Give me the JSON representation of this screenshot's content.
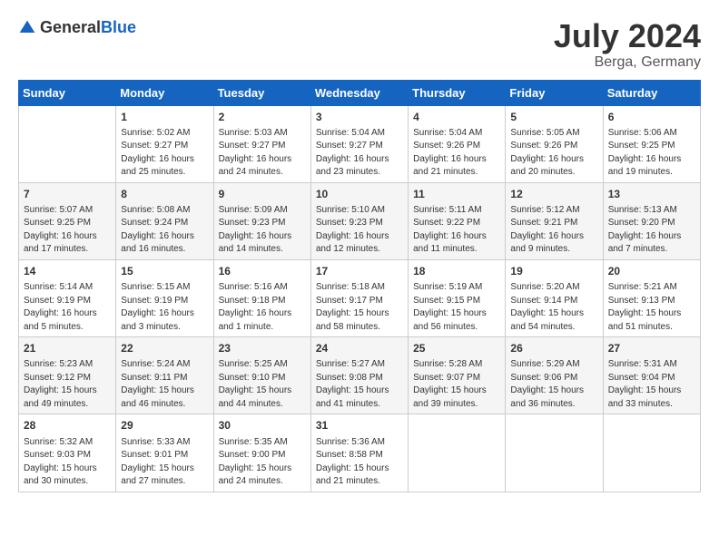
{
  "header": {
    "logo_general": "General",
    "logo_blue": "Blue",
    "month_year": "July 2024",
    "location": "Berga, Germany"
  },
  "calendar": {
    "days_of_week": [
      "Sunday",
      "Monday",
      "Tuesday",
      "Wednesday",
      "Thursday",
      "Friday",
      "Saturday"
    ],
    "weeks": [
      [
        {
          "day": "",
          "info": ""
        },
        {
          "day": "1",
          "info": "Sunrise: 5:02 AM\nSunset: 9:27 PM\nDaylight: 16 hours\nand 25 minutes."
        },
        {
          "day": "2",
          "info": "Sunrise: 5:03 AM\nSunset: 9:27 PM\nDaylight: 16 hours\nand 24 minutes."
        },
        {
          "day": "3",
          "info": "Sunrise: 5:04 AM\nSunset: 9:27 PM\nDaylight: 16 hours\nand 23 minutes."
        },
        {
          "day": "4",
          "info": "Sunrise: 5:04 AM\nSunset: 9:26 PM\nDaylight: 16 hours\nand 21 minutes."
        },
        {
          "day": "5",
          "info": "Sunrise: 5:05 AM\nSunset: 9:26 PM\nDaylight: 16 hours\nand 20 minutes."
        },
        {
          "day": "6",
          "info": "Sunrise: 5:06 AM\nSunset: 9:25 PM\nDaylight: 16 hours\nand 19 minutes."
        }
      ],
      [
        {
          "day": "7",
          "info": "Sunrise: 5:07 AM\nSunset: 9:25 PM\nDaylight: 16 hours\nand 17 minutes."
        },
        {
          "day": "8",
          "info": "Sunrise: 5:08 AM\nSunset: 9:24 PM\nDaylight: 16 hours\nand 16 minutes."
        },
        {
          "day": "9",
          "info": "Sunrise: 5:09 AM\nSunset: 9:23 PM\nDaylight: 16 hours\nand 14 minutes."
        },
        {
          "day": "10",
          "info": "Sunrise: 5:10 AM\nSunset: 9:23 PM\nDaylight: 16 hours\nand 12 minutes."
        },
        {
          "day": "11",
          "info": "Sunrise: 5:11 AM\nSunset: 9:22 PM\nDaylight: 16 hours\nand 11 minutes."
        },
        {
          "day": "12",
          "info": "Sunrise: 5:12 AM\nSunset: 9:21 PM\nDaylight: 16 hours\nand 9 minutes."
        },
        {
          "day": "13",
          "info": "Sunrise: 5:13 AM\nSunset: 9:20 PM\nDaylight: 16 hours\nand 7 minutes."
        }
      ],
      [
        {
          "day": "14",
          "info": "Sunrise: 5:14 AM\nSunset: 9:19 PM\nDaylight: 16 hours\nand 5 minutes."
        },
        {
          "day": "15",
          "info": "Sunrise: 5:15 AM\nSunset: 9:19 PM\nDaylight: 16 hours\nand 3 minutes."
        },
        {
          "day": "16",
          "info": "Sunrise: 5:16 AM\nSunset: 9:18 PM\nDaylight: 16 hours\nand 1 minute."
        },
        {
          "day": "17",
          "info": "Sunrise: 5:18 AM\nSunset: 9:17 PM\nDaylight: 15 hours\nand 58 minutes."
        },
        {
          "day": "18",
          "info": "Sunrise: 5:19 AM\nSunset: 9:15 PM\nDaylight: 15 hours\nand 56 minutes."
        },
        {
          "day": "19",
          "info": "Sunrise: 5:20 AM\nSunset: 9:14 PM\nDaylight: 15 hours\nand 54 minutes."
        },
        {
          "day": "20",
          "info": "Sunrise: 5:21 AM\nSunset: 9:13 PM\nDaylight: 15 hours\nand 51 minutes."
        }
      ],
      [
        {
          "day": "21",
          "info": "Sunrise: 5:23 AM\nSunset: 9:12 PM\nDaylight: 15 hours\nand 49 minutes."
        },
        {
          "day": "22",
          "info": "Sunrise: 5:24 AM\nSunset: 9:11 PM\nDaylight: 15 hours\nand 46 minutes."
        },
        {
          "day": "23",
          "info": "Sunrise: 5:25 AM\nSunset: 9:10 PM\nDaylight: 15 hours\nand 44 minutes."
        },
        {
          "day": "24",
          "info": "Sunrise: 5:27 AM\nSunset: 9:08 PM\nDaylight: 15 hours\nand 41 minutes."
        },
        {
          "day": "25",
          "info": "Sunrise: 5:28 AM\nSunset: 9:07 PM\nDaylight: 15 hours\nand 39 minutes."
        },
        {
          "day": "26",
          "info": "Sunrise: 5:29 AM\nSunset: 9:06 PM\nDaylight: 15 hours\nand 36 minutes."
        },
        {
          "day": "27",
          "info": "Sunrise: 5:31 AM\nSunset: 9:04 PM\nDaylight: 15 hours\nand 33 minutes."
        }
      ],
      [
        {
          "day": "28",
          "info": "Sunrise: 5:32 AM\nSunset: 9:03 PM\nDaylight: 15 hours\nand 30 minutes."
        },
        {
          "day": "29",
          "info": "Sunrise: 5:33 AM\nSunset: 9:01 PM\nDaylight: 15 hours\nand 27 minutes."
        },
        {
          "day": "30",
          "info": "Sunrise: 5:35 AM\nSunset: 9:00 PM\nDaylight: 15 hours\nand 24 minutes."
        },
        {
          "day": "31",
          "info": "Sunrise: 5:36 AM\nSunset: 8:58 PM\nDaylight: 15 hours\nand 21 minutes."
        },
        {
          "day": "",
          "info": ""
        },
        {
          "day": "",
          "info": ""
        },
        {
          "day": "",
          "info": ""
        }
      ]
    ]
  }
}
